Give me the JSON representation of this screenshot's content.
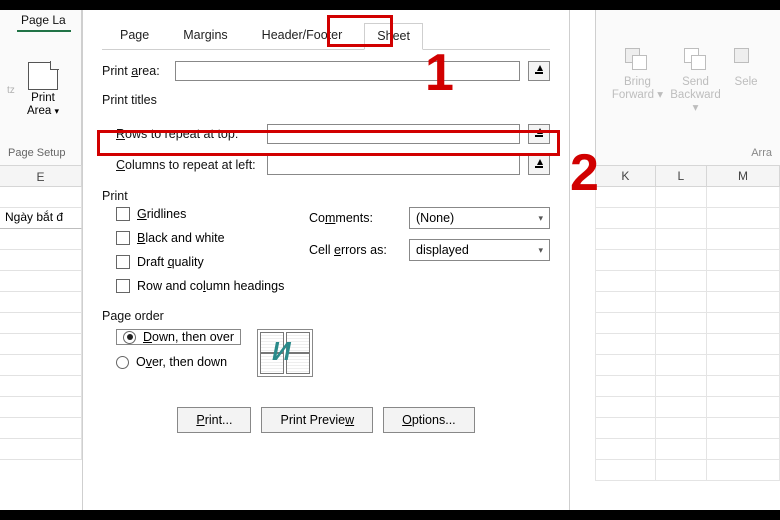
{
  "ribbon_left": {
    "tab_visible": "Page La",
    "print_area": "Print\nArea",
    "tz": "tz",
    "group": "Page Setup"
  },
  "ribbon_right": {
    "bring": "Bring\nForward",
    "send": "Send\nBackward",
    "sele": "Sele",
    "group": "Arra"
  },
  "sheet_left": {
    "col_header": "E",
    "first_cell": "Ngày bắt đ"
  },
  "sheet_right": {
    "cols": [
      "K",
      "L",
      "M"
    ]
  },
  "dialog": {
    "tabs": {
      "page": "Page",
      "margins": "Margins",
      "header_footer": "Header/Footer",
      "sheet": "Sheet"
    },
    "print_area_label": "Print area:",
    "print_area_value": "",
    "print_titles_label": "Print titles",
    "rows_label": "Rows to repeat at top:",
    "rows_value": "",
    "cols_label": "Columns to repeat at left:",
    "cols_value": "",
    "print_label": "Print",
    "checks": {
      "gridlines": "Gridlines",
      "bw": "Black and white",
      "draft": "Draft quality",
      "rowcol": "Row and column headings"
    },
    "dropdowns": {
      "comments_label": "Comments:",
      "comments_value": "(None)",
      "errors_label": "Cell errors as:",
      "errors_value": "displayed"
    },
    "order_label": "Page order",
    "radios": {
      "down": "Down, then over",
      "over": "Over, then down"
    },
    "buttons": {
      "print": "Print...",
      "preview": "Print Preview",
      "options": "Options..."
    }
  },
  "annotations": {
    "num1": "1",
    "num2": "2"
  }
}
